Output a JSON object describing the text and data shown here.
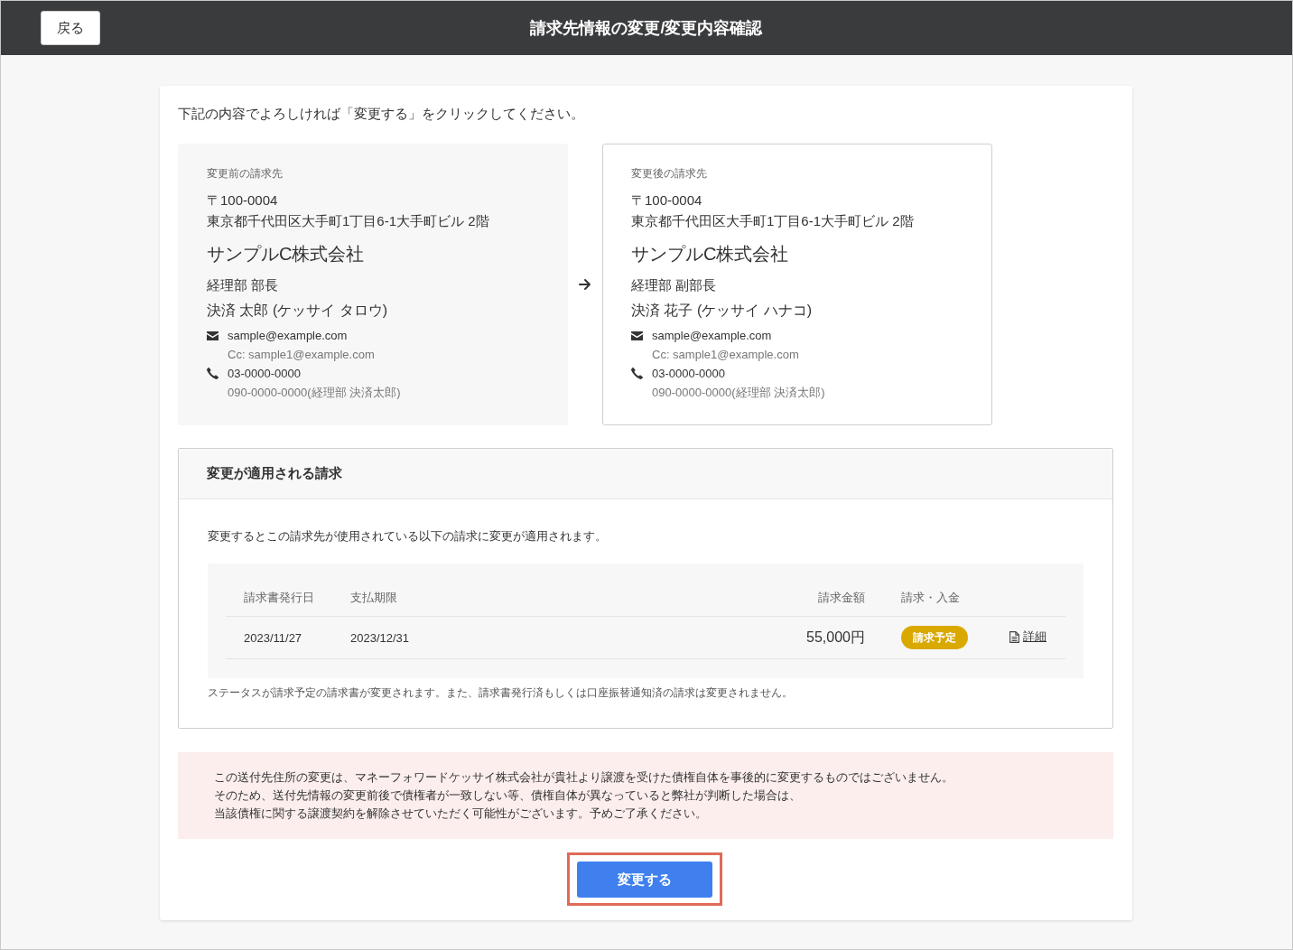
{
  "header": {
    "back_button": "戻る",
    "title": "請求先情報の変更/変更内容確認"
  },
  "instruction": "下記の内容でよろしければ「変更する」をクリックしてください。",
  "billing_destinations": [
    {
      "kind": "before",
      "label": "変更前の請求先",
      "postal_code": "〒100-0004",
      "address": "東京都千代田区大手町1丁目6-1大手町ビル 2階",
      "company": "サンプルC株式会社",
      "department_title": "経理部 部長",
      "contact_name": "決済 太郎 (ケッサイ タロウ)",
      "email": "sample@example.com",
      "cc": "Cc: sample1@example.com",
      "phone": "03-0000-0000",
      "phone_note": "090-0000-0000(経理部 決済太郎)"
    },
    {
      "kind": "after",
      "label": "変更後の請求先",
      "postal_code": "〒100-0004",
      "address": "東京都千代田区大手町1丁目6-1大手町ビル 2階",
      "company": "サンプルC株式会社",
      "department_title": "経理部 副部長",
      "contact_name": "決済 花子 (ケッサイ ハナコ)",
      "email": "sample@example.com",
      "cc": "Cc: sample1@example.com",
      "phone": "03-0000-0000",
      "phone_note": "090-0000-0000(経理部 決済太郎)"
    }
  ],
  "affected_invoices": {
    "title": "変更が適用される請求",
    "description": "変更するとこの請求先が使用されている以下の請求に変更が適用されます。",
    "table": {
      "columns": [
        "請求書発行日",
        "支払期限",
        "請求金額",
        "請求・入金"
      ],
      "rows": [
        {
          "issue_date": "2023/11/27",
          "due_date": "2023/12/31",
          "amount": "55,000円",
          "status": "請求予定",
          "detail_link": "詳細"
        }
      ]
    },
    "note": "ステータスが請求予定の請求書が変更されます。また、請求書発行済もしくは口座振替通知済の請求は変更されません。"
  },
  "notice": {
    "lines": [
      "この送付先住所の変更は、マネーフォワードケッサイ株式会社が貴社より譲渡を受けた債権自体を事後的に変更するものではございません。",
      "そのため、送付先情報の変更前後で債権者が一致しない等、債権自体が異なっていると弊社が判断した場合は、",
      "当該債権に関する譲渡契約を解除させていただく可能性がございます。予めご了承ください。"
    ]
  },
  "submit_button": {
    "label": "変更する",
    "highlighted": true
  }
}
